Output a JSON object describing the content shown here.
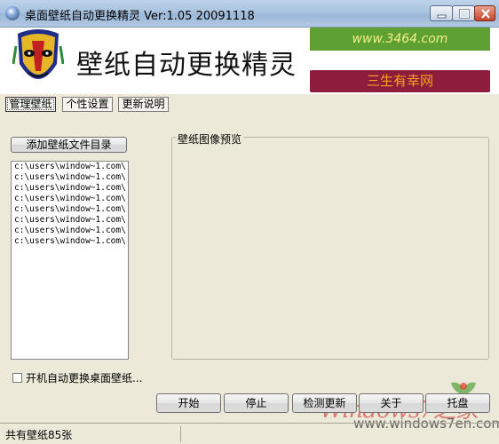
{
  "window": {
    "title": "桌面壁纸自动更换精灵 Ver:1.05 20091118",
    "icons": [
      "app-icon",
      "minimize-icon",
      "maximize-icon",
      "close-icon"
    ]
  },
  "banner": {
    "title": "壁纸自动更换精灵",
    "site_url": "www.3464.com",
    "slogan": "三生有幸网",
    "colors": {
      "green": "#5fa033",
      "red": "#8e1d3d"
    }
  },
  "tabs": [
    {
      "label": "管理壁纸",
      "selected": true
    },
    {
      "label": "个性设置",
      "selected": false
    },
    {
      "label": "更新说明",
      "selected": false
    }
  ],
  "manage": {
    "add_dir_button": "添加壁纸文件目录",
    "directories": [
      "c:\\users\\window~1.com\\",
      "c:\\users\\window~1.com\\",
      "c:\\users\\window~1.com\\",
      "c:\\users\\window~1.com\\",
      "c:\\users\\window~1.com\\",
      "c:\\users\\window~1.com\\",
      "c:\\users\\window~1.com\\",
      "c:\\users\\window~1.com\\"
    ],
    "preview_group_label": "壁纸图像预览",
    "autostart_checkbox": {
      "label": "开机自动更换桌面壁纸...",
      "checked": false
    }
  },
  "actions": {
    "start": "开始",
    "stop": "停止",
    "check_update": "检测更新",
    "about": "关于",
    "tray": "托盘"
  },
  "watermark": {
    "text": "Windows7之家",
    "url": "www.windows7en.com"
  },
  "status": {
    "count_text": "共有壁纸85张"
  }
}
